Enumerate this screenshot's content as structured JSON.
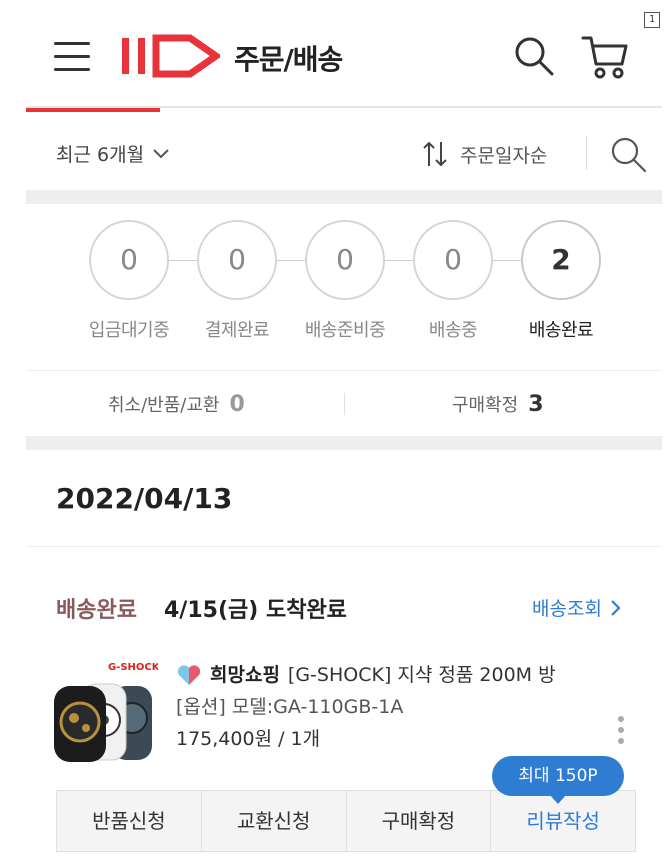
{
  "header": {
    "title": "주문/배송",
    "logo_text": "11st"
  },
  "corner_badge": "1",
  "filter": {
    "period_label": "최근 6개월",
    "sort_label": "주문일자순"
  },
  "steps": [
    {
      "count": "0",
      "label": "입금대기중",
      "active": false
    },
    {
      "count": "0",
      "label": "결제완료",
      "active": false
    },
    {
      "count": "0",
      "label": "배송준비중",
      "active": false
    },
    {
      "count": "0",
      "label": "배송중",
      "active": false
    },
    {
      "count": "2",
      "label": "배송완료",
      "active": true
    }
  ],
  "summary": {
    "cancel_label": "취소/반품/교환",
    "cancel_count": "0",
    "confirm_label": "구매확정",
    "confirm_count": "3"
  },
  "order": {
    "date": "2022/04/13",
    "status": "배송완료",
    "arrival": "4/15(금) 도착완료",
    "track_label": "배송조회",
    "product_brand_badge": "G-SHOCK",
    "seller": "희망쇼핑",
    "product_name": "[G-SHOCK] 지샥 정품 200M 방",
    "option": "[옵션] 모델:GA-110GB-1A",
    "price": "175,400원 / 1개",
    "review_bubble": "최대 150P",
    "actions": [
      "반품신청",
      "교환신청",
      "구매확정",
      "리뷰작성"
    ]
  },
  "colors": {
    "brand_red": "#e8333b",
    "accent_blue": "#2f7cd3",
    "status_brown": "#8a5a5a"
  }
}
